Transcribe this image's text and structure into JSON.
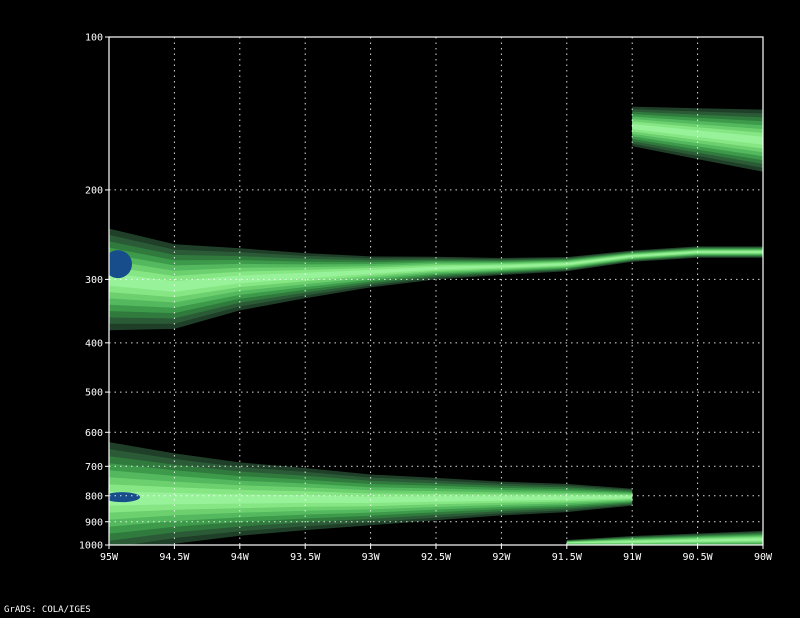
{
  "footer": {
    "credit": "GrADS: COLA/IGES"
  },
  "colors": {
    "background": "#000000",
    "frame": "#ffffff",
    "grid": "#ffffff",
    "shade_scale": [
      "#0a5a1e",
      "#127a2a",
      "#1e9634",
      "#3aa648",
      "#55c060",
      "#72d87a",
      "#8ff28f",
      "#2a6a3a",
      "#3a6a44",
      "#174d8a"
    ]
  },
  "chart_data": {
    "type": "heatmap",
    "title": "",
    "xlabel": "",
    "ylabel": "",
    "x_ticks": [
      "95W",
      "94.5W",
      "94W",
      "93.5W",
      "93W",
      "92.5W",
      "92W",
      "91.5W",
      "91W",
      "90.5W",
      "90W"
    ],
    "x_range": [
      -95,
      -90
    ],
    "y_ticks": [
      "100",
      "200",
      "300",
      "400",
      "500",
      "600",
      "700",
      "800",
      "900",
      "1000"
    ],
    "y_range": [
      1000,
      100
    ],
    "y_scale": "log-pressure",
    "grid": true,
    "layers": [
      {
        "name": "upper-band",
        "points": [
          [
            -95,
            300
          ],
          [
            -94.5,
            310
          ],
          [
            -94,
            300
          ],
          [
            -93.5,
            295
          ],
          [
            -93,
            290
          ],
          [
            -92.5,
            285
          ],
          [
            -92,
            283
          ],
          [
            -91.5,
            280
          ],
          [
            -91,
            270
          ],
          [
            -90.5,
            265
          ],
          [
            -90,
            265
          ]
        ],
        "thickness": [
          180,
          150,
          110,
          80,
          55,
          40,
          30,
          25,
          20,
          20,
          20
        ]
      },
      {
        "name": "top-right-core",
        "points": [
          [
            -91,
            150
          ],
          [
            -90.5,
            155
          ],
          [
            -90,
            160
          ]
        ],
        "thickness": [
          70,
          90,
          110
        ]
      },
      {
        "name": "lower-band",
        "points": [
          [
            -95,
            810
          ],
          [
            -94.5,
            810
          ],
          [
            -94,
            812
          ],
          [
            -93.5,
            812
          ],
          [
            -93,
            815
          ],
          [
            -92.5,
            812
          ],
          [
            -92,
            810
          ],
          [
            -91.5,
            808
          ],
          [
            -91,
            805
          ]
        ],
        "thickness": [
          200,
          160,
          130,
          110,
          90,
          75,
          60,
          50,
          30
        ]
      },
      {
        "name": "surface-strip",
        "points": [
          [
            -91.5,
            990
          ],
          [
            -91,
            985
          ],
          [
            -90.5,
            980
          ],
          [
            -90,
            975
          ]
        ],
        "thickness": [
          10,
          20,
          25,
          30
        ]
      }
    ]
  }
}
